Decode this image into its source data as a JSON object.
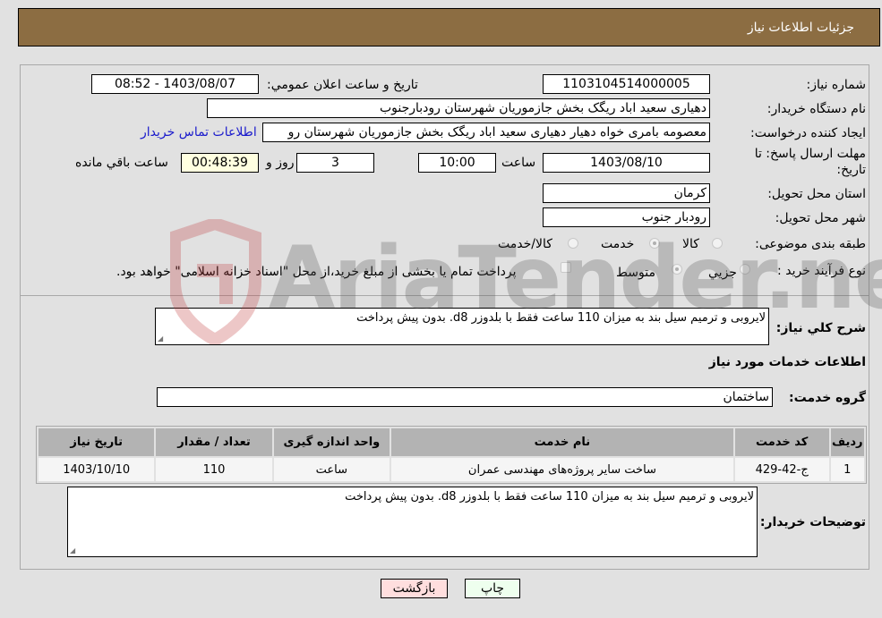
{
  "header": {
    "title": "جزئیات اطلاعات نیاز"
  },
  "form": {
    "need_number": {
      "label": "شماره نیاز:",
      "value": "1103104514000005"
    },
    "announce_datetime": {
      "label": "تاریخ و ساعت اعلان عمومي:",
      "value": "1403/08/07 - 08:52"
    },
    "buyer_org": {
      "label": "نام دستگاه خریدار:",
      "value": "دهیاری سعید اباد ریگک بخش جازموریان شهرستان رودبارجنوب"
    },
    "requester": {
      "label": "ایجاد کننده درخواست:",
      "value": "معصومه بامری خواه دهیار دهیاری سعید اباد ریگک بخش جازموریان شهرستان رو",
      "contact_link": "اطلاعات تماس خریدار"
    },
    "deadline": {
      "label_line1": "مهلت ارسال پاسخ: تا",
      "label_line2": "تاریخ:",
      "date": "1403/08/10",
      "time_label": "ساعت",
      "time": "10:00",
      "days": "3",
      "days_label": "روز و",
      "remaining": "00:48:39",
      "remaining_label": "ساعت باقي مانده"
    },
    "province": {
      "label": "استان محل تحویل:",
      "value": "کرمان"
    },
    "city": {
      "label": "شهر محل تحویل:",
      "value": "رودبار جنوب"
    },
    "category": {
      "label": "طبقه بندی موضوعی:",
      "options": [
        "کالا",
        "خدمت",
        "کالا/خدمت"
      ],
      "selected": "خدمت"
    },
    "purchase_type": {
      "label": "نوع فرآیند خرید :",
      "options": [
        "جزيي",
        "متوسط"
      ],
      "selected": "متوسط",
      "treasury_note": "پرداخت تمام یا بخشی از مبلغ خرید،از محل \"اسناد خزانه اسلامی\" خواهد بود."
    }
  },
  "description": {
    "label": "شرح کلي نیاز:",
    "value": "لایروبی و ترمیم سیل بند به میزان 110 ساعت فقط با بلدوزر d8. بدون پیش پرداخت"
  },
  "services_section": {
    "title": "اطلاعات خدمات مورد نیاز"
  },
  "service_group": {
    "label": "گروه خدمت:",
    "value": "ساختمان"
  },
  "table": {
    "headers": [
      "ردیف",
      "کد خدمت",
      "نام خدمت",
      "واحد اندازه گیری",
      "تعداد / مقدار",
      "تاریخ نیاز"
    ],
    "rows": [
      [
        "1",
        "ج-42-429",
        "ساخت سایر پروژه‌های مهندسی عمران",
        "ساعت",
        "110",
        "1403/10/10"
      ]
    ]
  },
  "buyer_notes": {
    "label": "توضیحات خریدار:",
    "value": "لایروبی و ترمیم سیل بند به میزان 110 ساعت فقط با بلدوزر d8. بدون پیش پرداخت"
  },
  "buttons": {
    "print": "چاپ",
    "back": "بازگشت"
  },
  "watermark": {
    "text": "AriaTender.neT"
  }
}
